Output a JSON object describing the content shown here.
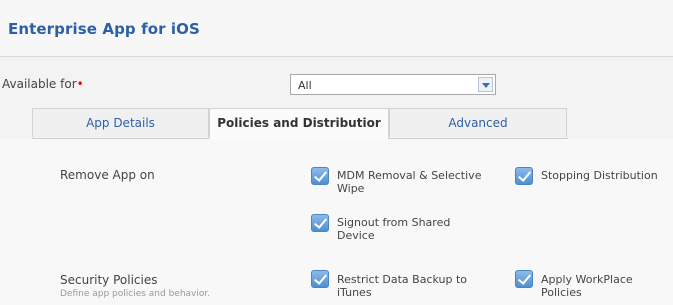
{
  "header": {
    "title": "Enterprise App for iOS"
  },
  "available_for": {
    "label": "Available for",
    "required_mark": "•",
    "select": {
      "value": "All"
    }
  },
  "tabs": [
    {
      "label": "App Details",
      "active": false
    },
    {
      "label": "Policies and Distributior",
      "active": true
    },
    {
      "label": "Advanced",
      "active": false
    }
  ],
  "remove_app": {
    "label": "Remove App on",
    "options": [
      {
        "label": "MDM Removal & Selective Wipe",
        "checked": true
      },
      {
        "label": "Stopping Distribution",
        "checked": true
      },
      {
        "label": "Signout from Shared Device",
        "checked": true
      }
    ]
  },
  "security_policies": {
    "label": "Security Policies",
    "sublabel": "Define app policies and behavior.",
    "options": [
      {
        "label": "Restrict Data Backup to iTunes",
        "checked": true
      },
      {
        "label": "Apply WorkPlace Policies",
        "checked": true
      }
    ]
  }
}
